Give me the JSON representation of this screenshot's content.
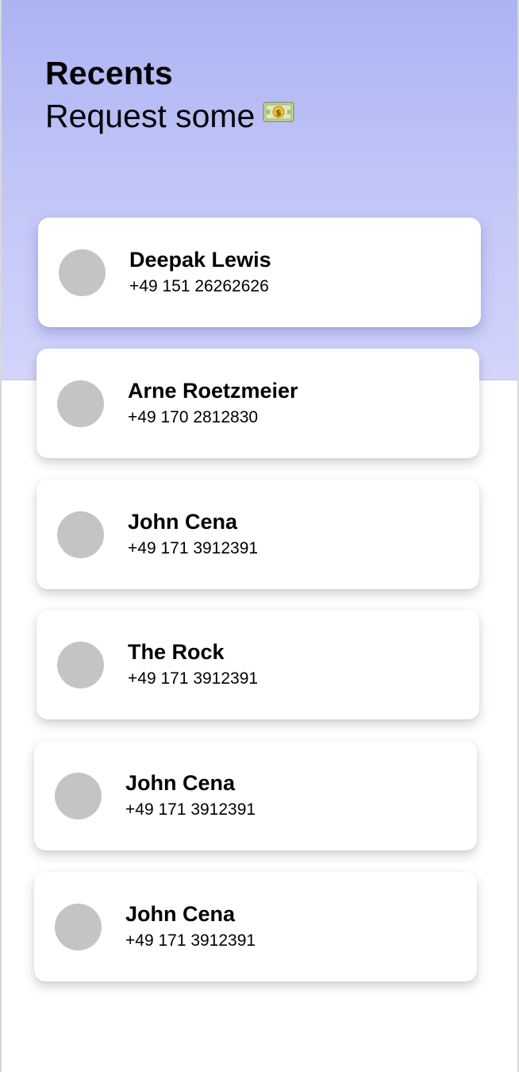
{
  "header": {
    "title": "Recents",
    "subtitle": "Request some",
    "subtitle_icon": "money-banknote-icon",
    "gradient_top": "#abb3f2",
    "gradient_bottom": "#d2d4fb"
  },
  "contacts": [
    {
      "name": "Deepak Lewis",
      "phone": "+49 151 26262626"
    },
    {
      "name": "Arne Roetzmeier",
      "phone": "+49 170 2812830"
    },
    {
      "name": "John Cena",
      "phone": "+49 171 3912391"
    },
    {
      "name": "The Rock",
      "phone": "+49 171 3912391"
    },
    {
      "name": "John Cena",
      "phone": "+49 171 3912391"
    },
    {
      "name": "John Cena",
      "phone": "+49 171 3912391"
    }
  ],
  "colors": {
    "avatar_placeholder": "#c4c4c4",
    "card_background": "#ffffff"
  }
}
